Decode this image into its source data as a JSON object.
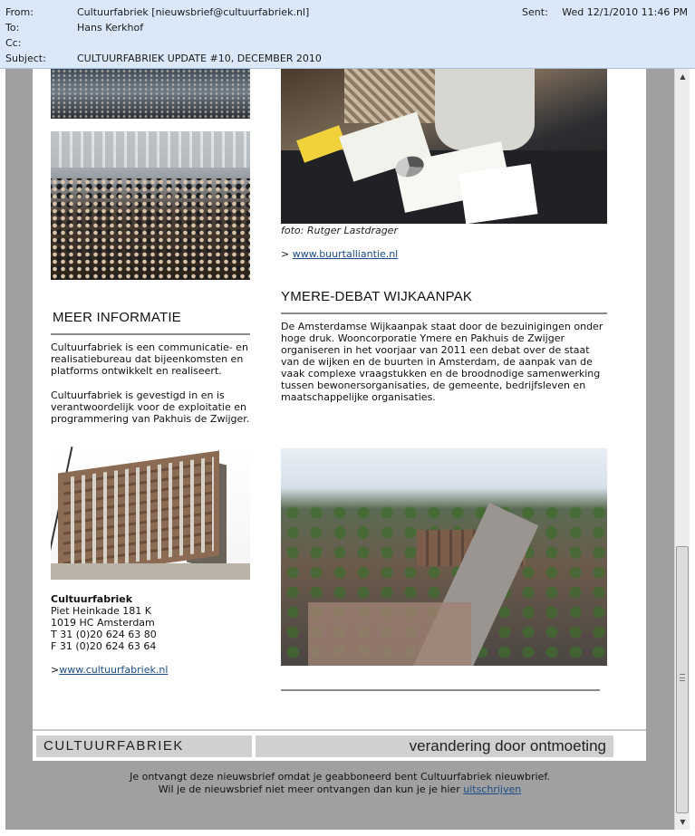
{
  "email": {
    "from_label": "From:",
    "from_value": "Cultuurfabriek [nieuwsbrief@cultuurfabriek.nl]",
    "to_label": "To:",
    "to_value": "Hans Kerkhof",
    "cc_label": "Cc:",
    "cc_value": "",
    "subject_label": "Subject:",
    "subject_value": "CULTUURFABRIEK UPDATE #10, DECEMBER 2010",
    "sent_label": "Sent:",
    "sent_value": "Wed 12/1/2010 11:46 PM"
  },
  "newsletter": {
    "photo_caption": "foto: Rutger Lastdrager",
    "link_prefix": ">",
    "link_buurtalliantie": "www.buurtalliantie.nl",
    "meer_informatie": {
      "heading": "MEER INFORMATIE",
      "para1": "Cultuurfabriek is een communicatie- en realisatiebureau dat bijeenkomsten en platforms ontwikkelt en realiseert.",
      "para2": "Cultuurfabriek is gevestigd in en is verantwoordelijk voor de exploitatie en programmering van Pakhuis de Zwijger."
    },
    "address": {
      "name": "Cultuurfabriek",
      "street": "Piet Heinkade 181 K",
      "city": "1019 HC Amsterdam",
      "phone": "T 31 (0)20 624 63 80",
      "fax": "F 31 (0)20 624 63 64",
      "link_prefix": ">",
      "link": "www.cultuurfabriek.nl"
    },
    "ymere": {
      "heading": "YMERE-DEBAT WIJKAANPAK",
      "body": "De Amsterdamse Wijkaanpak staat door de bezuinigingen onder hoge druk. Wooncorporatie Ymere en Pakhuis de Zwijger organiseren in het voorjaar van 2011 een debat over de staat van de wijken en de buurten in Amsterdam, de aanpak van de vaak complexe vraagstukken en de broodnodige samenwerking tussen bewonersorganisaties, de gemeente, bedrijfsleven en maatschappelijke organisaties."
    },
    "banner": {
      "left": "CULTUURFABRIEK",
      "right": "verandering door ontmoeting"
    },
    "footer": {
      "line1": "Je ontvangt deze nieuwsbrief omdat je geabboneerd bent Cultuurfabriek nieuwbrief.",
      "line2_prefix": "Wil je de nieuwsbrief niet meer ontvangen dan kun je je hier",
      "unsubscribe": "uitschrijven"
    }
  }
}
